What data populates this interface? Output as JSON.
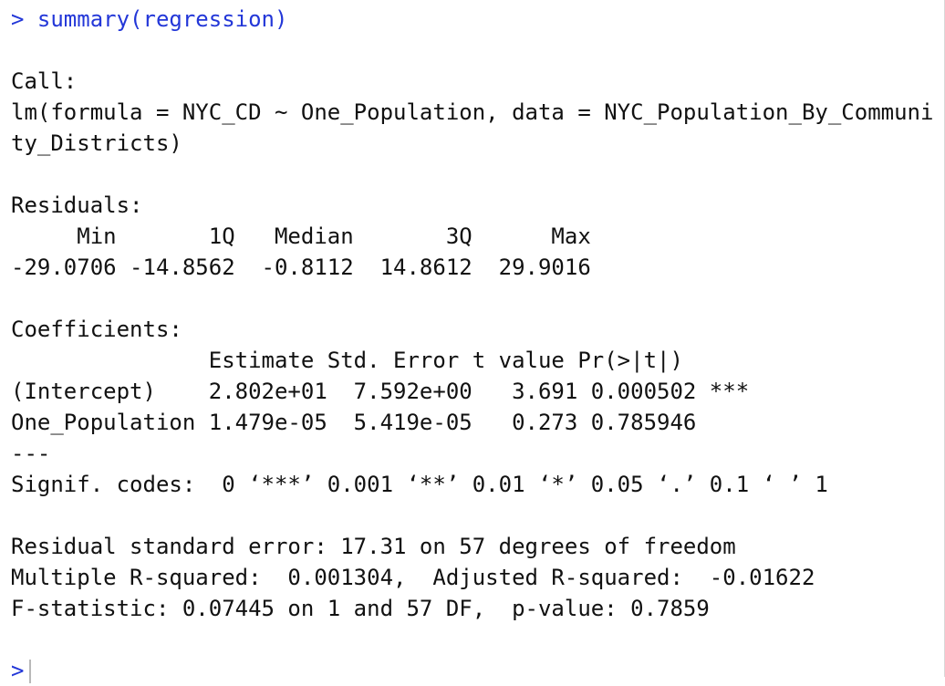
{
  "console": {
    "prompt_symbol": ">",
    "command": "summary(regression)",
    "call_header": "Call:",
    "call_line1": "lm(formula = NYC_CD ~ One_Population, data = NYC_Population_By_Communi",
    "call_line2": "ty_Districts)",
    "residuals_header": "Residuals:",
    "residuals_labels": "     Min       1Q   Median       3Q      Max ",
    "residuals_values": "-29.0706 -14.8562  -0.8112  14.8612  29.9016 ",
    "coefficients_header": "Coefficients:",
    "coef_header_row": "               Estimate Std. Error t value Pr(>|t|)    ",
    "coef_rows": [
      "(Intercept)    2.802e+01  7.592e+00   3.691 0.000502 ***",
      "One_Population 1.479e-05  5.419e-05   0.273 0.785946    "
    ],
    "separator": "---",
    "signif_codes": "Signif. codes:  0 ‘***’ 0.001 ‘**’ 0.01 ‘*’ 0.05 ‘.’ 0.1 ‘ ’ 1",
    "rse_line": "Residual standard error: 17.31 on 57 degrees of freedom",
    "r2_line": "Multiple R-squared:  0.001304,\tAdjusted R-squared:  -0.01622 ",
    "f_line": "F-statistic: 0.07445 on 1 and 57 DF,  p-value: 0.7859",
    "final_prompt": ">"
  }
}
